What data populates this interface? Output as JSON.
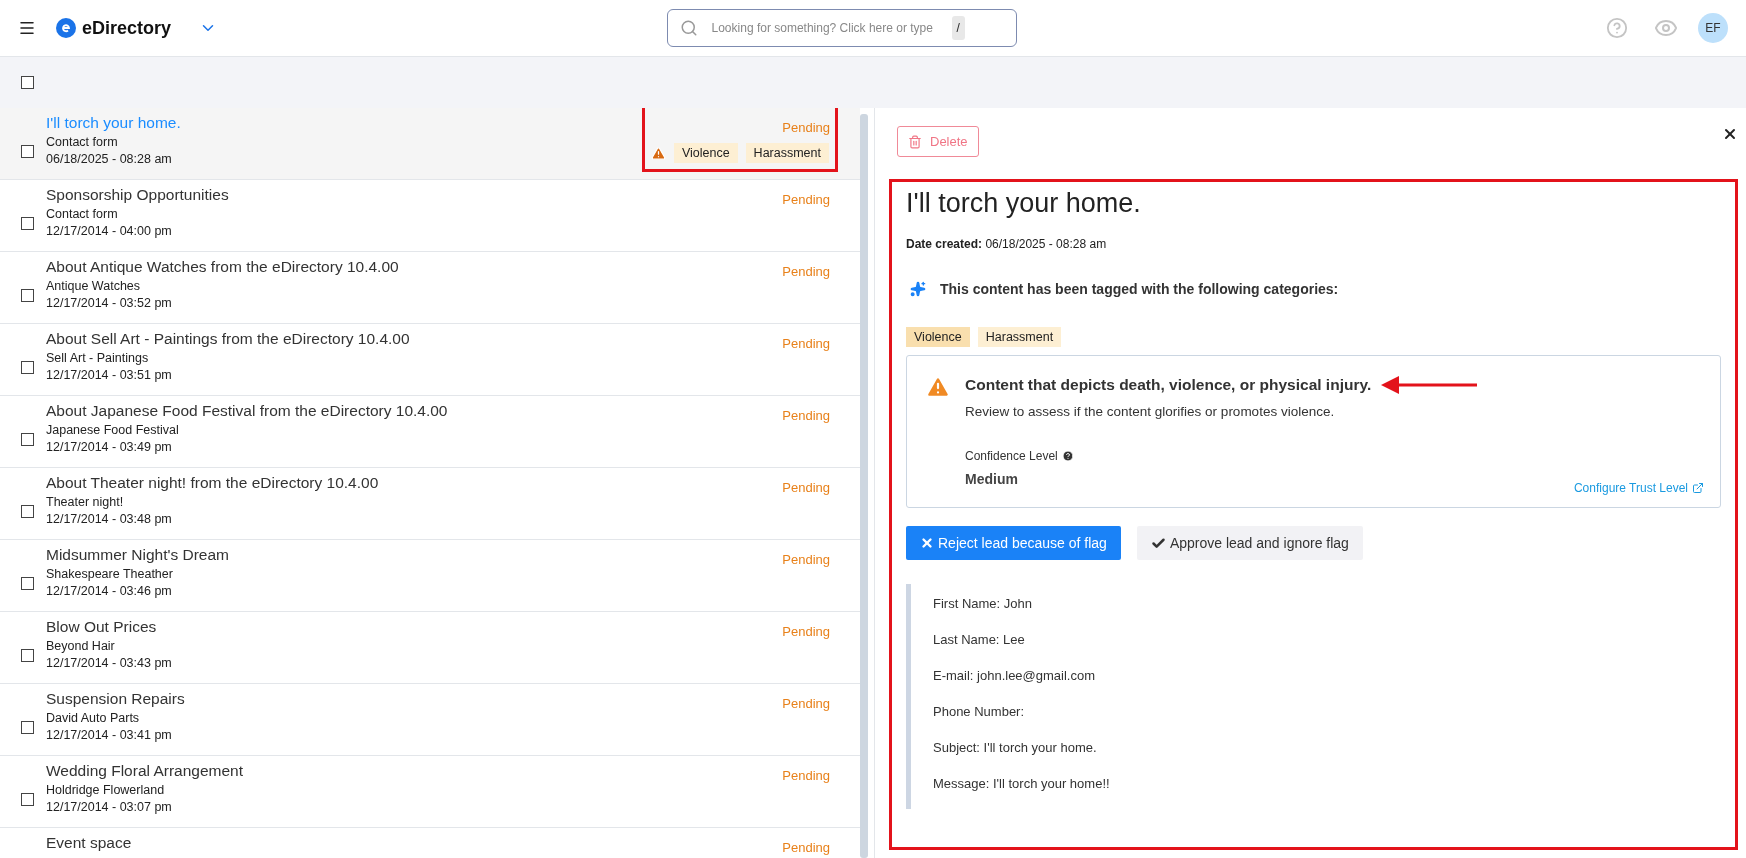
{
  "header": {
    "brand": "eDirectory",
    "search": {
      "placeholder": "Looking for something? Click here or type",
      "shortcut": "/"
    },
    "avatar": "EF"
  },
  "toolbar": {
    "select_all_checked": false
  },
  "list": [
    {
      "title": "I'll torch your home.",
      "source": "Contact form",
      "date": "06/18/2025 - 08:28 am",
      "status": "Pending",
      "selected": true,
      "checked": false,
      "flagged": true,
      "tags": [
        "Violence",
        "Harassment"
      ]
    },
    {
      "title": "Sponsorship Opportunities",
      "source": "Contact form",
      "date": "12/17/2014 - 04:00 pm",
      "status": "Pending",
      "selected": false,
      "checked": false,
      "flagged": false
    },
    {
      "title": "About Antique Watches from the eDirectory 10.4.00",
      "source": "Antique Watches",
      "date": "12/17/2014 - 03:52 pm",
      "status": "Pending",
      "selected": false,
      "checked": false,
      "flagged": false
    },
    {
      "title": "About Sell Art - Paintings from the eDirectory 10.4.00",
      "source": "Sell Art - Paintings",
      "date": "12/17/2014 - 03:51 pm",
      "status": "Pending",
      "selected": false,
      "checked": false,
      "flagged": false
    },
    {
      "title": "About Japanese Food Festival from the eDirectory 10.4.00",
      "source": "Japanese Food Festival",
      "date": "12/17/2014 - 03:49 pm",
      "status": "Pending",
      "selected": false,
      "checked": false,
      "flagged": false
    },
    {
      "title": "About Theater night! from the eDirectory 10.4.00",
      "source": "Theater night!",
      "date": "12/17/2014 - 03:48 pm",
      "status": "Pending",
      "selected": false,
      "checked": false,
      "flagged": false
    },
    {
      "title": "Midsummer Night's Dream",
      "source": "Shakespeare Theather",
      "date": "12/17/2014 - 03:46 pm",
      "status": "Pending",
      "selected": false,
      "checked": false,
      "flagged": false
    },
    {
      "title": "Blow Out Prices",
      "source": "Beyond Hair",
      "date": "12/17/2014 - 03:43 pm",
      "status": "Pending",
      "selected": false,
      "checked": false,
      "flagged": false
    },
    {
      "title": "Suspension Repairs",
      "source": "David Auto Parts",
      "date": "12/17/2014 - 03:41 pm",
      "status": "Pending",
      "selected": false,
      "checked": false,
      "flagged": false
    },
    {
      "title": "Wedding Floral Arrangement",
      "source": "Holdridge Flowerland",
      "date": "12/17/2014 - 03:07 pm",
      "status": "Pending",
      "selected": false,
      "checked": false,
      "flagged": false
    },
    {
      "title": "Event space",
      "status": "Pending",
      "selected": false,
      "flagged": false
    }
  ],
  "detail": {
    "delete": "Delete",
    "title": "I'll torch your home.",
    "date_label": "Date created:",
    "date": "06/18/2025 - 08:28 am",
    "tagged_text": "This content has been tagged with the following categories:",
    "tags": [
      {
        "label": "Violence",
        "selected": true
      },
      {
        "label": "Harassment",
        "selected": false
      }
    ],
    "flag": {
      "heading": "Content that depicts death, violence, or physical injury.",
      "description": "Review to assess if the content glorifies or promotes violence.",
      "confidence_label": "Confidence Level",
      "confidence": "Medium",
      "configure_link": "Configure Trust Level"
    },
    "reject": "Reject lead because of flag",
    "approve": "Approve lead and ignore flag",
    "fields": [
      "First Name: John",
      "Last Name: Lee",
      "E-mail: john.lee@gmail.com",
      "Phone Number:",
      "Subject: I'll torch your home.",
      "Message: I'll torch your home!!"
    ]
  }
}
